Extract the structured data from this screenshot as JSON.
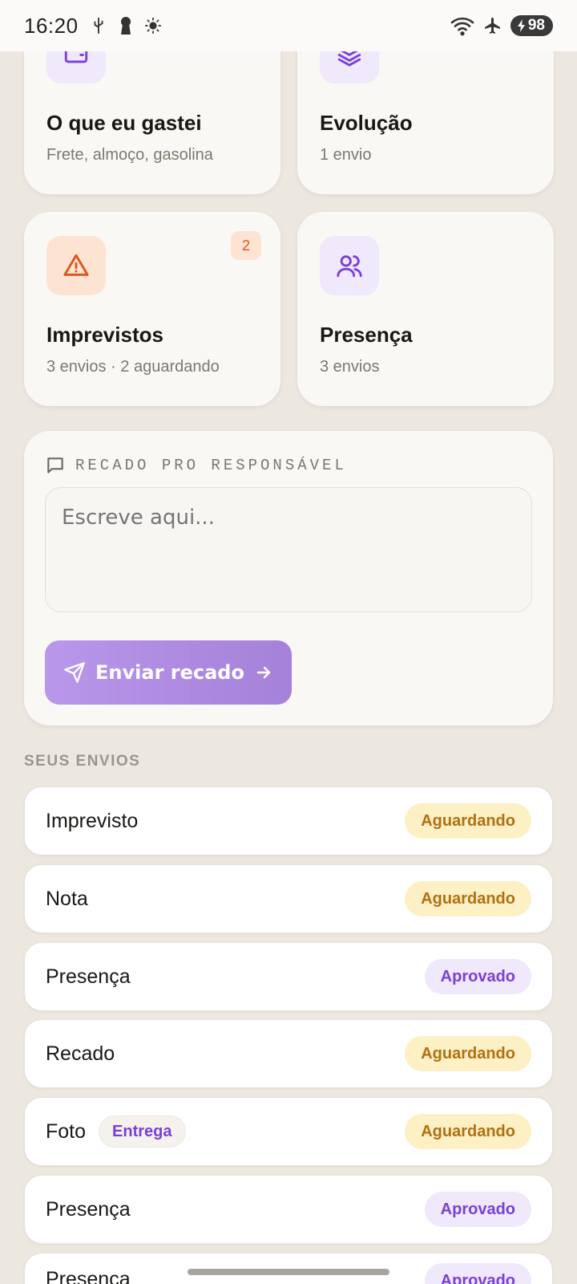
{
  "status_bar": {
    "time": "16:20",
    "battery": "98",
    "icons": [
      "usb-icon",
      "keyhole-icon",
      "brightness-icon",
      "wifi-icon",
      "airplane-icon",
      "battery-charging-icon"
    ]
  },
  "tiles": [
    {
      "title": "O que eu gastei",
      "subtitle": "Frete, almoço, gasolina",
      "icon": "wallet-icon"
    },
    {
      "title": "Evolução",
      "subtitle": "1 envio",
      "icon": "layers-icon"
    },
    {
      "title": "Imprevistos",
      "subtitle": "3 envios · 2 aguardando",
      "icon": "warning-icon",
      "badge": "2"
    },
    {
      "title": "Presença",
      "subtitle": "3 envios",
      "icon": "users-icon"
    }
  ],
  "message": {
    "label": "RECADO PRO RESPONSÁVEL",
    "placeholder": "Escreve aqui...",
    "send_label": "Enviar recado"
  },
  "submissions": {
    "title": "SEUS ENVIOS",
    "items": [
      {
        "label": "Imprevisto",
        "status": "Aguardando"
      },
      {
        "label": "Nota",
        "status": "Aguardando"
      },
      {
        "label": "Presença",
        "status": "Aprovado"
      },
      {
        "label": "Recado",
        "status": "Aguardando"
      },
      {
        "label": "Foto",
        "tag": "Entrega",
        "status": "Aguardando"
      },
      {
        "label": "Presença",
        "status": "Aprovado"
      },
      {
        "label": "Presença",
        "status": "Aprovado"
      }
    ]
  },
  "colors": {
    "accent": "#7a3fd6",
    "waiting_bg": "#fdf0c4",
    "waiting_text": "#b07012",
    "approved_bg": "#efe9fb",
    "warning": "#d9561c",
    "background": "#ece7df"
  }
}
